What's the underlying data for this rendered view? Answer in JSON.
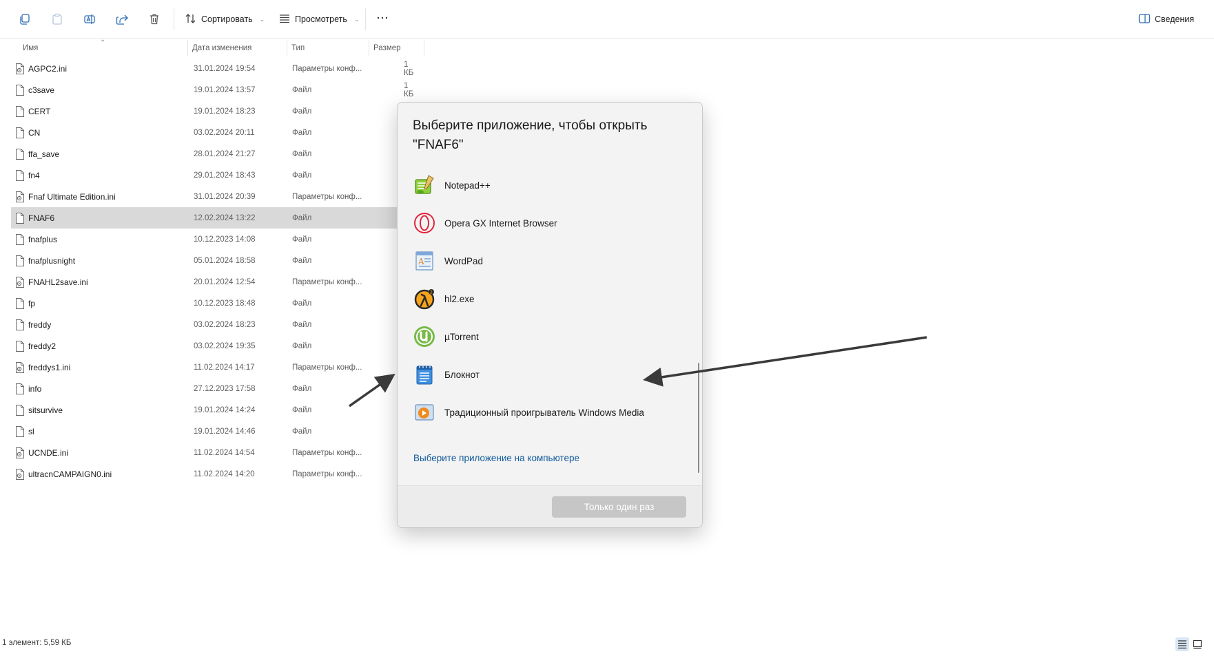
{
  "toolbar": {
    "sort_label": "Сортировать",
    "view_label": "Просмотреть",
    "details_label": "Сведения"
  },
  "columns": {
    "name": "Имя",
    "date": "Дата изменения",
    "type": "Тип",
    "size": "Размер"
  },
  "files": [
    {
      "name": "AGPC2.ini",
      "date": "31.01.2024 19:54",
      "type": "Параметры конф...",
      "size": "1 КБ",
      "icon": "config-file-icon"
    },
    {
      "name": "c3save",
      "date": "19.01.2024 13:57",
      "type": "Файл",
      "size": "1 КБ",
      "icon": "file-icon"
    },
    {
      "name": "CERT",
      "date": "19.01.2024 18:23",
      "type": "Файл",
      "size": "",
      "icon": "file-icon"
    },
    {
      "name": "CN",
      "date": "03.02.2024 20:11",
      "type": "Файл",
      "size": "",
      "icon": "file-icon"
    },
    {
      "name": "ffa_save",
      "date": "28.01.2024 21:27",
      "type": "Файл",
      "size": "",
      "icon": "file-icon"
    },
    {
      "name": "fn4",
      "date": "29.01.2024 18:43",
      "type": "Файл",
      "size": "",
      "icon": "file-icon"
    },
    {
      "name": "Fnaf Ultimate Edition.ini",
      "date": "31.01.2024 20:39",
      "type": "Параметры конф...",
      "size": "",
      "icon": "config-file-icon"
    },
    {
      "name": "FNAF6",
      "date": "12.02.2024 13:22",
      "type": "Файл",
      "size": "",
      "icon": "file-icon"
    },
    {
      "name": "fnafplus",
      "date": "10.12.2023 14:08",
      "type": "Файл",
      "size": "",
      "icon": "file-icon"
    },
    {
      "name": "fnafplusnight",
      "date": "05.01.2024 18:58",
      "type": "Файл",
      "size": "",
      "icon": "file-icon"
    },
    {
      "name": "FNAHL2save.ini",
      "date": "20.01.2024 12:54",
      "type": "Параметры конф...",
      "size": "",
      "icon": "config-file-icon"
    },
    {
      "name": "fp",
      "date": "10.12.2023 18:48",
      "type": "Файл",
      "size": "",
      "icon": "file-icon"
    },
    {
      "name": "freddy",
      "date": "03.02.2024 18:23",
      "type": "Файл",
      "size": "",
      "icon": "file-icon"
    },
    {
      "name": "freddy2",
      "date": "03.02.2024 19:35",
      "type": "Файл",
      "size": "",
      "icon": "file-icon"
    },
    {
      "name": "freddys1.ini",
      "date": "11.02.2024 14:17",
      "type": "Параметры конф...",
      "size": "",
      "icon": "config-file-icon"
    },
    {
      "name": "info",
      "date": "27.12.2023 17:58",
      "type": "Файл",
      "size": "",
      "icon": "file-icon"
    },
    {
      "name": "sitsurvive",
      "date": "19.01.2024 14:24",
      "type": "Файл",
      "size": "",
      "icon": "file-icon"
    },
    {
      "name": "sl",
      "date": "19.01.2024 14:46",
      "type": "Файл",
      "size": "",
      "icon": "file-icon"
    },
    {
      "name": "UCNDE.ini",
      "date": "11.02.2024 14:54",
      "type": "Параметры конф...",
      "size": "",
      "icon": "config-file-icon"
    },
    {
      "name": "ultracnCAMPAIGN0.ini",
      "date": "11.02.2024 14:20",
      "type": "Параметры конф...",
      "size": "",
      "icon": "config-file-icon"
    }
  ],
  "selected_file": "FNAF6",
  "status": {
    "text": "1 элемент: 5,59 КБ"
  },
  "dialog": {
    "title": "Выберите приложение, чтобы открыть \"FNAF6\"",
    "apps": [
      {
        "label": "Notepad++",
        "icon": "notepad-plus-plus-icon"
      },
      {
        "label": "Opera GX Internet Browser",
        "icon": "opera-gx-icon"
      },
      {
        "label": "WordPad",
        "icon": "wordpad-icon"
      },
      {
        "label": "hl2.exe",
        "icon": "half-life-icon"
      },
      {
        "label": "µTorrent",
        "icon": "utorrent-icon"
      },
      {
        "label": "Блокнот",
        "icon": "notepad-icon"
      },
      {
        "label": "Традиционный проигрыватель Windows Media",
        "icon": "windows-media-player-icon"
      }
    ],
    "choose_link": "Выберите приложение на компьютере",
    "once_button": "Только один раз"
  },
  "colors": {
    "selected_row": "#d9d9d9",
    "link": "#105a9c",
    "toolbar_icon": "#2f6db5",
    "disabled_button": "#c6c6c6"
  }
}
